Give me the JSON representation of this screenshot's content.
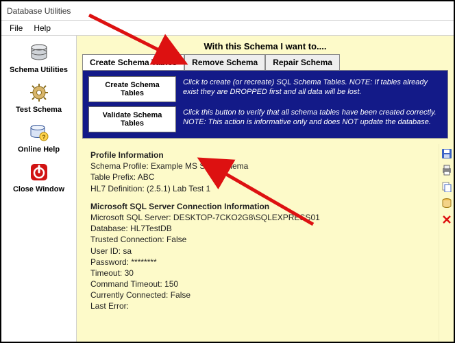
{
  "window": {
    "title": "Database Utilities"
  },
  "menu": {
    "file": "File",
    "help": "Help"
  },
  "sidebar": {
    "items": [
      {
        "label": "Schema Utilities"
      },
      {
        "label": "Test Schema"
      },
      {
        "label": "Online Help"
      },
      {
        "label": "Close Window"
      }
    ]
  },
  "header": "With this Schema I want to....",
  "tabs": [
    {
      "label": "Create Schema Tables"
    },
    {
      "label": "Remove Schema"
    },
    {
      "label": "Repair Schema"
    }
  ],
  "panel": {
    "rows": [
      {
        "button": "Create Schema Tables",
        "desc": "Click to create (or recreate) SQL Schema Tables. NOTE: If tables already exist they are DROPPED first and all data will be lost."
      },
      {
        "button": "Validate Schema Tables",
        "desc": "Click this button to verify that all schema tables have been created correctly. NOTE: This action is informative only and does NOT update the database."
      }
    ]
  },
  "profile": {
    "heading": "Profile Information",
    "line1": "Schema Profile: Example MS SQL Schema",
    "line2": "Table Prefix: ABC",
    "line3": "HL7 Definition: (2.5.1) Lab Test 1"
  },
  "conn": {
    "heading": "Microsoft SQL Server Connection Information",
    "line1": "Microsoft SQL Server: DESKTOP-7CKO2G8\\SQLEXPRESS01",
    "line2": "Database: HL7TestDB",
    "line3": "Trusted Connection: False",
    "line4": "User ID: sa",
    "line5": "Password: ********",
    "line6": "Timeout: 30",
    "line7": "Command Timeout: 150",
    "line8": "Currently Connected: False",
    "line9": "Last Error:"
  }
}
